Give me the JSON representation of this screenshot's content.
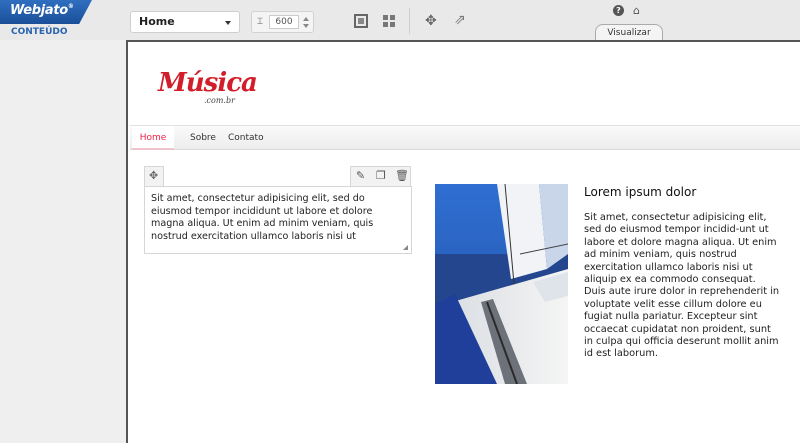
{
  "brand": {
    "logo": "Webjato",
    "registered": "®",
    "section_label": "CONTEÚDO"
  },
  "toolbar": {
    "page_select": "Home",
    "width_value": "600",
    "icons": [
      "layout-single-icon",
      "layout-grid-icon",
      "move-icon",
      "share-icon",
      "help-icon",
      "home-icon"
    ]
  },
  "preview_tab": "Visualizar",
  "site": {
    "logo_main": "Música",
    "logo_sub": ".com.br",
    "nav": [
      "Home",
      "Sobre",
      "Contato"
    ]
  },
  "text_block": {
    "content": "Sit amet, consectetur adipisicing elit, sed do eiusmod tempor incididunt ut  labore et dolore magna aliqua. Ut enim ad minim veniam, quis nostrud exercitation ullamco laboris nisi ut"
  },
  "article": {
    "title": "Lorem ipsum dolor",
    "body": "Sit amet, consectetur adipisicing elit, sed do eiusmod tempor incidid-unt ut  labore et dolore magna aliqua. Ut enim ad minim veniam, quis nostrud exercitation ullamco laboris nisi ut aliquip ex ea commodo consequat. Duis aute irure dolor in reprehenderit in voluptate velit esse cillum dolore eu fugiat nulla pariatur. Excepteur sint occaecat cupidatat non proident, sunt in culpa qui officia deserunt mollit anim id est laborum."
  },
  "colors": {
    "brand_blue": "#1b4f98",
    "logo_red": "#d11e2a",
    "nav_active": "#e24"
  }
}
